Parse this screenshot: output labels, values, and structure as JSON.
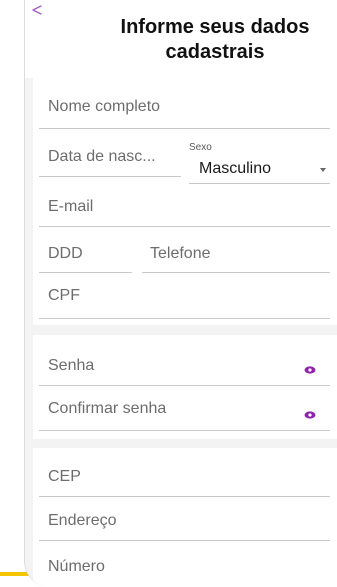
{
  "header": {
    "back_icon": "back-arrow-icon",
    "title": "Informe seus dados cadastrais"
  },
  "personal": {
    "nome_placeholder": "Nome completo",
    "data_nasc_placeholder": "Data de nasc...",
    "sexo_label": "Sexo",
    "sexo_value": "Masculino",
    "email_placeholder": "E-mail",
    "ddd_placeholder": "DDD",
    "telefone_placeholder": "Telefone",
    "cpf_placeholder": "CPF"
  },
  "password": {
    "senha_placeholder": "Senha",
    "confirmar_placeholder": "Confirmar senha",
    "visibility_icon": "eye-icon"
  },
  "address": {
    "cep_placeholder": "CEP",
    "endereco_placeholder": "Endereço",
    "numero_placeholder": "Número"
  },
  "colors": {
    "accent": "#8e24aa",
    "background": "#f3f3f3",
    "stripe": "#f4c400"
  }
}
